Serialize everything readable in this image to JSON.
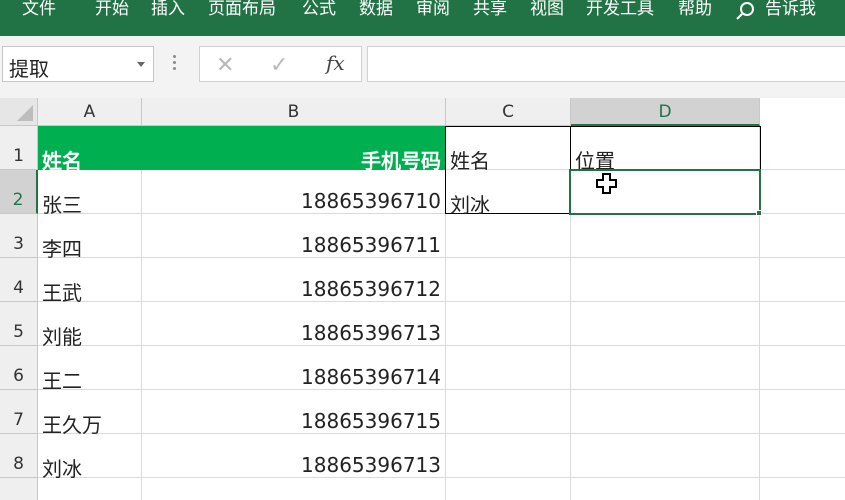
{
  "ribbon": {
    "tabs": [
      "文件",
      "开始",
      "插入",
      "页面布局",
      "公式",
      "数据",
      "审阅",
      "共享",
      "视图",
      "开发工具",
      "帮助"
    ],
    "tell_me": "告诉我"
  },
  "formula_bar": {
    "name_box": "提取",
    "formula": ""
  },
  "columns": [
    "A",
    "B",
    "C",
    "D"
  ],
  "rows": [
    "1",
    "2",
    "3",
    "4",
    "5",
    "6",
    "7",
    "8"
  ],
  "selected": {
    "column": "D",
    "row": "2"
  },
  "sheet": {
    "header": {
      "name": "姓名",
      "phone": "手机号码"
    },
    "records": [
      {
        "name": "张三",
        "phone": "18865396710"
      },
      {
        "name": "李四",
        "phone": "18865396711"
      },
      {
        "name": "王武",
        "phone": "18865396712"
      },
      {
        "name": "刘能",
        "phone": "18865396713"
      },
      {
        "name": "王二",
        "phone": "18865396714"
      },
      {
        "name": "王久万",
        "phone": "18865396715"
      },
      {
        "name": "刘冰",
        "phone": "18865396713"
      }
    ],
    "lookup": {
      "name_label": "姓名",
      "pos_label": "位置",
      "name_value": "刘冰",
      "pos_value": ""
    }
  },
  "colors": {
    "ribbon": "#217346",
    "header_fill": "#00b050"
  }
}
